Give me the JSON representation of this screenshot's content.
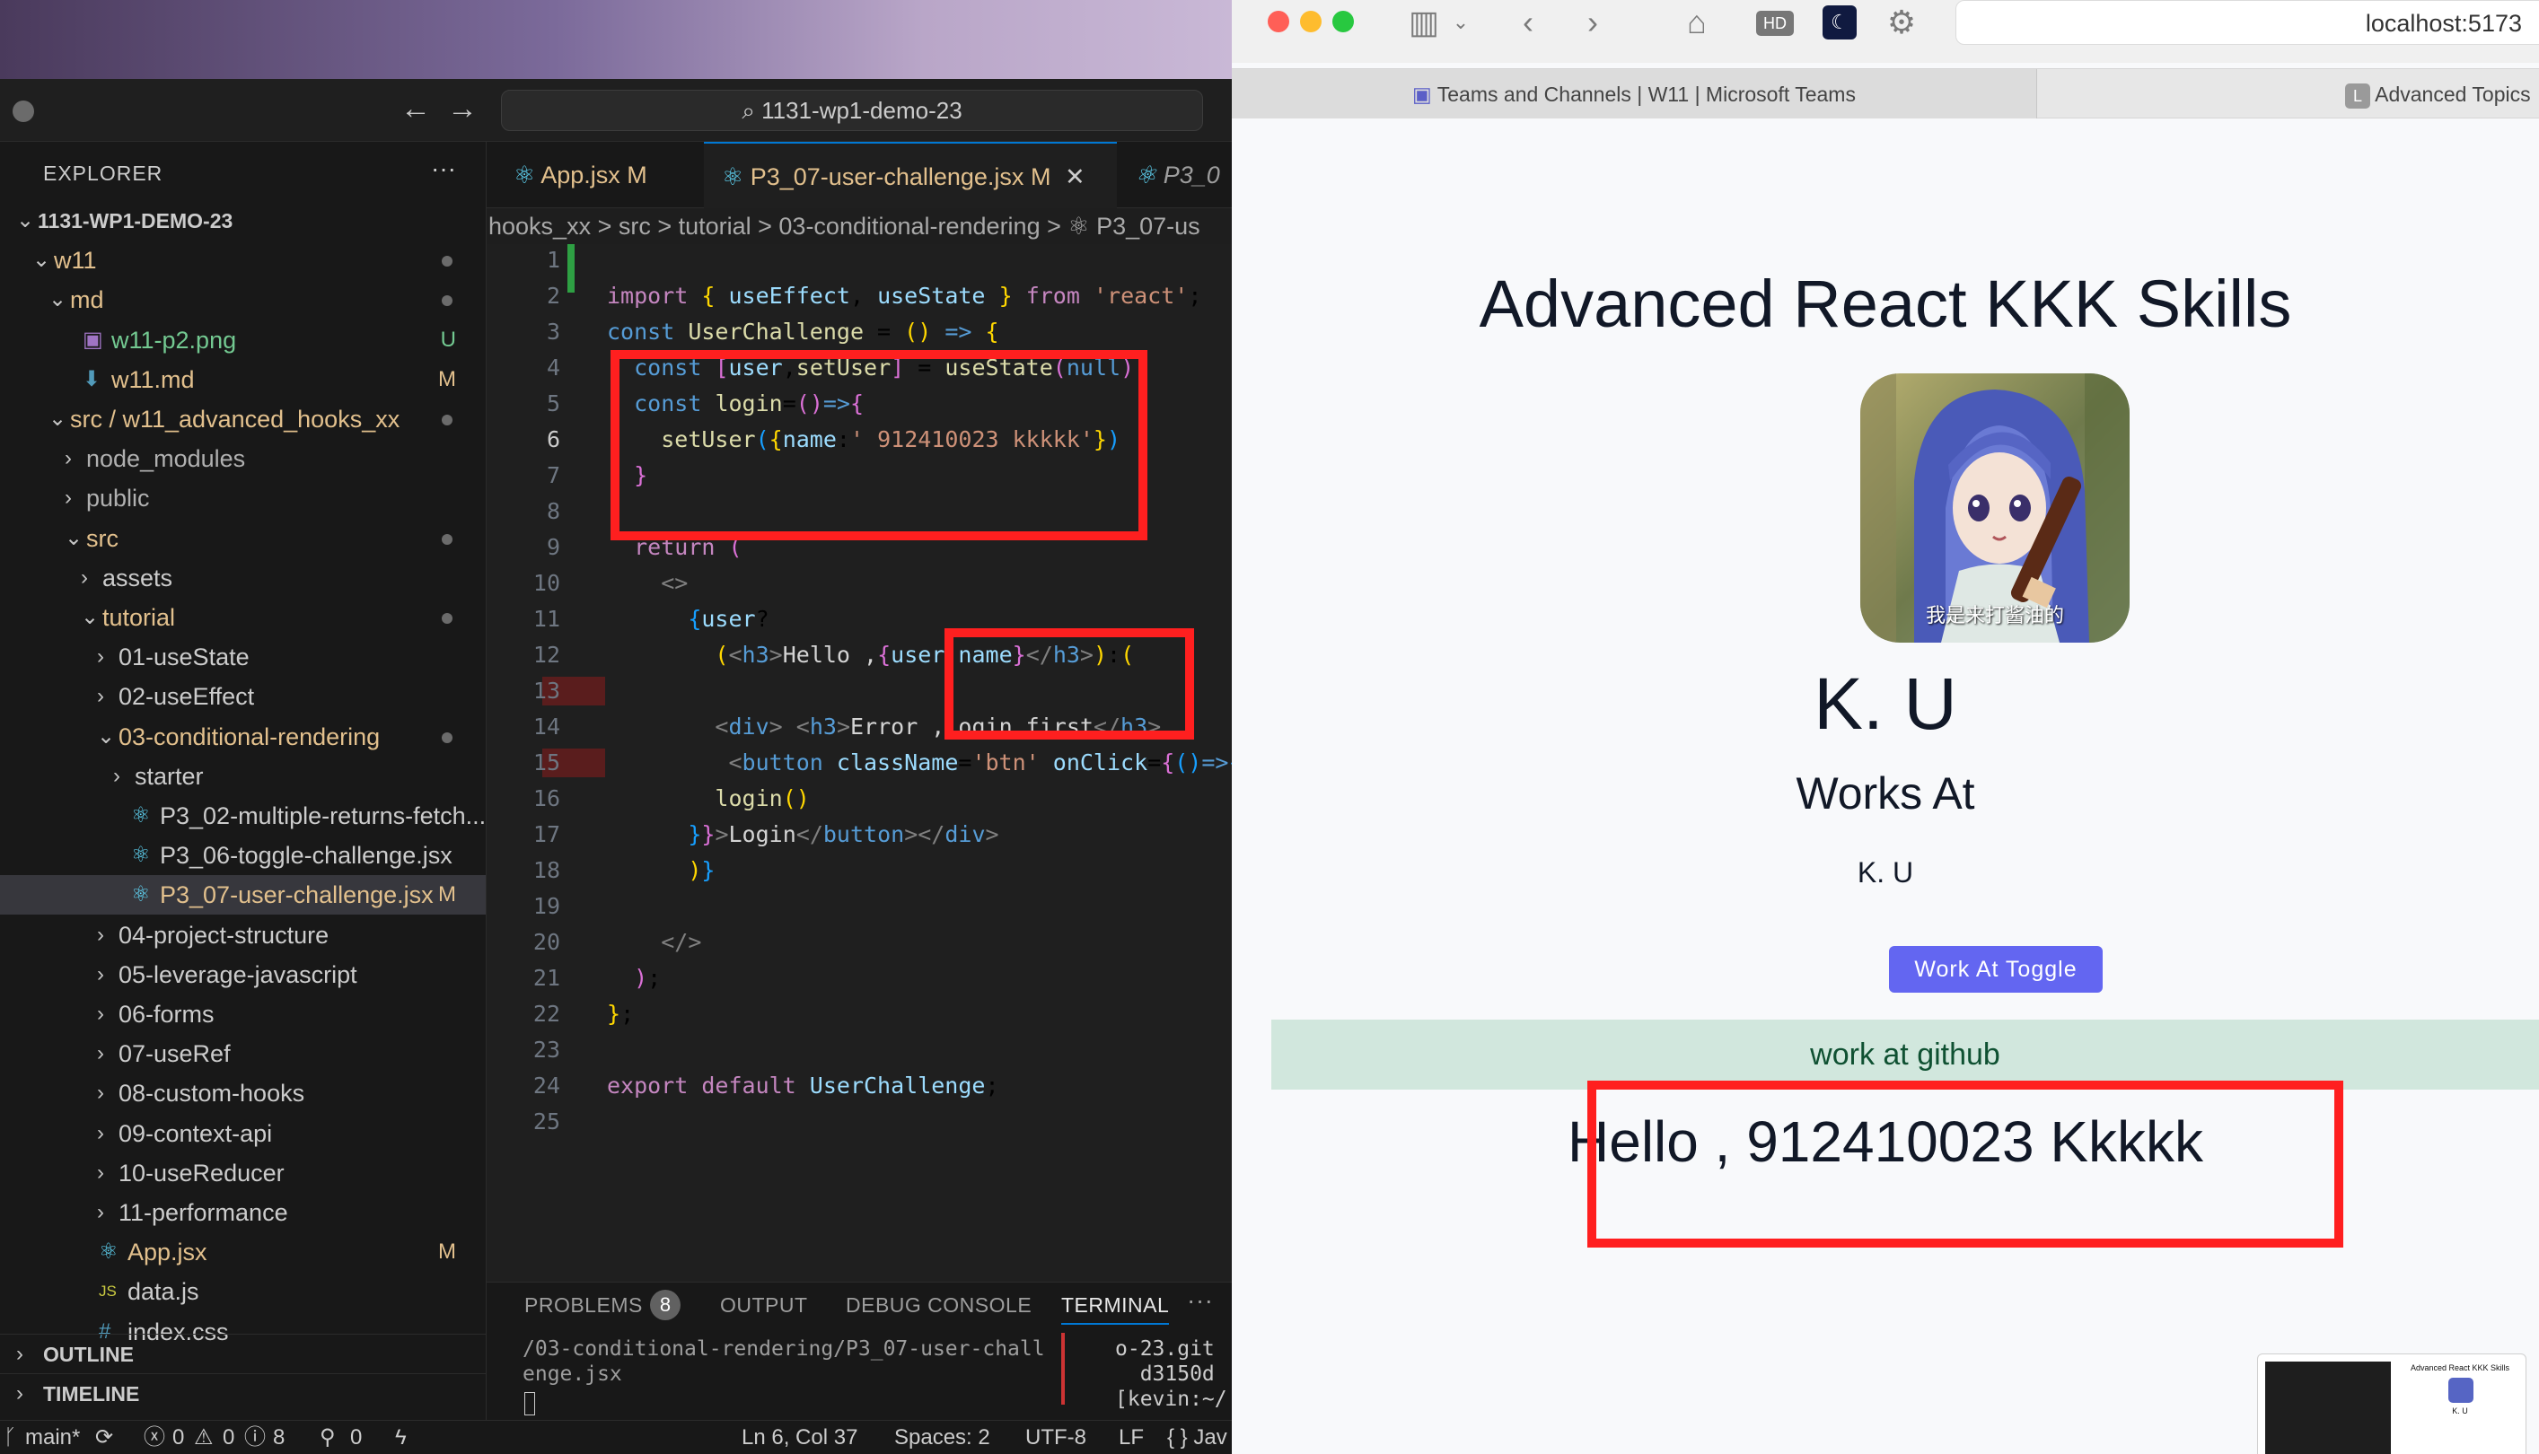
{
  "vscode": {
    "command_center": "1131-wp1-demo-23",
    "explorer_title": "EXPLORER",
    "tree": [
      {
        "label": "1131-WP1-DEMO-23",
        "kind": "root",
        "status": ""
      },
      {
        "label": "w11",
        "kind": "folder-open",
        "status": "dot"
      },
      {
        "label": "md",
        "kind": "folder-open",
        "status": "dot"
      },
      {
        "label": "w11-p2.png",
        "kind": "image",
        "status": "U"
      },
      {
        "label": "w11.md",
        "kind": "md",
        "status": "M"
      },
      {
        "label": "src / w11_advanced_hooks_xx",
        "kind": "folder-open",
        "status": "dot"
      },
      {
        "label": "node_modules",
        "kind": "folder",
        "status": ""
      },
      {
        "label": "public",
        "kind": "folder",
        "status": ""
      },
      {
        "label": "src",
        "kind": "folder-open",
        "status": "dot"
      },
      {
        "label": "assets",
        "kind": "folder",
        "status": ""
      },
      {
        "label": "tutorial",
        "kind": "folder-open",
        "status": "dot"
      },
      {
        "label": "01-useState",
        "kind": "folder",
        "status": ""
      },
      {
        "label": "02-useEffect",
        "kind": "folder",
        "status": ""
      },
      {
        "label": "03-conditional-rendering",
        "kind": "folder-open",
        "status": "dot"
      },
      {
        "label": "starter",
        "kind": "folder",
        "status": ""
      },
      {
        "label": "P3_02-multiple-returns-fetch...",
        "kind": "react",
        "status": ""
      },
      {
        "label": "P3_06-toggle-challenge.jsx",
        "kind": "react",
        "status": ""
      },
      {
        "label": "P3_07-user-challenge.jsx",
        "kind": "react",
        "status": "M"
      },
      {
        "label": "04-project-structure",
        "kind": "folder",
        "status": ""
      },
      {
        "label": "05-leverage-javascript",
        "kind": "folder",
        "status": ""
      },
      {
        "label": "06-forms",
        "kind": "folder",
        "status": ""
      },
      {
        "label": "07-useRef",
        "kind": "folder",
        "status": ""
      },
      {
        "label": "08-custom-hooks",
        "kind": "folder",
        "status": ""
      },
      {
        "label": "09-context-api",
        "kind": "folder",
        "status": ""
      },
      {
        "label": "10-useReducer",
        "kind": "folder",
        "status": ""
      },
      {
        "label": "11-performance",
        "kind": "folder",
        "status": ""
      },
      {
        "label": "App.jsx",
        "kind": "react",
        "status": "M"
      },
      {
        "label": "data.js",
        "kind": "js",
        "status": ""
      },
      {
        "label": "index.css",
        "kind": "css",
        "status": ""
      }
    ],
    "outline_label": "OUTLINE",
    "timeline_label": "TIMELINE",
    "tabs": [
      {
        "label": "App.jsx",
        "status": "M"
      },
      {
        "label": "P3_07-user-challenge.jsx",
        "status": "M"
      },
      {
        "label": "P3_0",
        "status": ""
      }
    ],
    "breadcrumb": "hooks_xx  >  src  >  tutorial  >  03-conditional-rendering  >  ⚛ P3_07-us",
    "panel_tabs": {
      "problems": "PROBLEMS",
      "problems_count": "8",
      "output": "OUTPUT",
      "debug": "DEBUG CONSOLE",
      "terminal": "TERMINAL"
    },
    "terminal_left": "/03-conditional-rendering/P3_07-user-chall\nenge.jsx",
    "terminal_right": "o-23.git\n  d3150d\n[kevin:~/",
    "status": {
      "branch": "main*",
      "errors": "0",
      "warnings": "0",
      "infos": "8",
      "ports": "0",
      "position": "Ln 6, Col 37",
      "spaces": "Spaces: 2",
      "encoding": "UTF-8",
      "eol": "LF",
      "lang": "{ } Jav"
    }
  },
  "code_lines": [
    "1",
    "2",
    "3",
    "4",
    "5",
    "6",
    "7",
    "8",
    "9",
    "10",
    "11",
    "12",
    "13",
    "14",
    "15",
    "16",
    "17",
    "18",
    "19",
    "20",
    "21",
    "22",
    "23",
    "24",
    "25"
  ],
  "browser": {
    "url": "localhost:5173",
    "tabs": [
      {
        "label": "Teams and Channels | W11 | Microsoft Teams"
      },
      {
        "label": "Advanced Topics"
      }
    ],
    "page": {
      "heading": "Advanced React KKK Skills",
      "avatar_caption": "我是来打酱油的",
      "name": "K. U",
      "works_at": "Works At",
      "sub_name": "K. U",
      "toggle_button": "Work At Toggle",
      "work_bar": "work at github",
      "hello": "Hello , 912410023 Kkkkk"
    },
    "thumb_title": "Advanced React KKK Skills",
    "thumb_name": "K. U"
  },
  "colors": {
    "accent": "#0078d4",
    "highlight": "#ff1f1f",
    "button": "#6366f1",
    "workbar": "#d1e7dd"
  }
}
